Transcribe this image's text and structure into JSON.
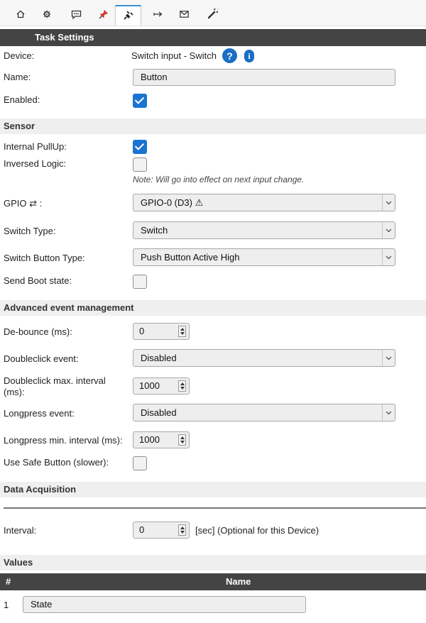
{
  "tabs": [
    {
      "icon": "home-icon",
      "active": false
    },
    {
      "icon": "gear-icon",
      "active": false
    },
    {
      "icon": "chat-icon",
      "active": false
    },
    {
      "icon": "pin-icon",
      "active": false
    },
    {
      "icon": "plug-icon",
      "active": true
    },
    {
      "icon": "arrow-icon",
      "active": false
    },
    {
      "icon": "mail-icon",
      "active": false
    },
    {
      "icon": "wrench-icon",
      "active": false
    }
  ],
  "task_settings": {
    "title": "Task Settings",
    "device_label": "Device:",
    "device_value": "Switch input - Switch",
    "help_glyph": "?",
    "info_glyph": "i",
    "name_label": "Name:",
    "name_value": "Button",
    "enabled_label": "Enabled:",
    "enabled_checked": true
  },
  "sensor": {
    "title": "Sensor",
    "pullup_label": "Internal PullUp:",
    "pullup_checked": true,
    "inversed_label": "Inversed Logic:",
    "inversed_checked": false,
    "note": "Note: Will go into effect on next input change.",
    "gpio_label": "GPIO ⇄ :",
    "gpio_value": "GPIO-0 (D3) ⚠",
    "switch_type_label": "Switch Type:",
    "switch_type_value": "Switch",
    "switch_button_type_label": "Switch Button Type:",
    "switch_button_type_value": "Push Button Active High",
    "boot_state_label": "Send Boot state:",
    "boot_state_checked": false
  },
  "advanced": {
    "title": "Advanced event management",
    "debounce_label": "De-bounce (ms):",
    "debounce_value": "0",
    "doubleclick_label": "Doubleclick event:",
    "doubleclick_value": "Disabled",
    "dbl_interval_label_1": "Doubleclick max. interval",
    "dbl_interval_label_2": "(ms):",
    "dbl_interval_value": "1000",
    "longpress_label": "Longpress event:",
    "longpress_value": "Disabled",
    "longpress_interval_label": "Longpress min. interval (ms):",
    "longpress_interval_value": "1000",
    "safe_button_label": "Use Safe Button (slower):",
    "safe_button_checked": false
  },
  "data_acquisition": {
    "title": "Data Acquisition",
    "interval_label": "Interval:",
    "interval_value": "0",
    "interval_suffix": "[sec] (Optional for this Device)"
  },
  "values": {
    "title": "Values",
    "col_num": "#",
    "col_name": "Name",
    "rows": [
      {
        "num": "1",
        "name": "State"
      }
    ]
  }
}
